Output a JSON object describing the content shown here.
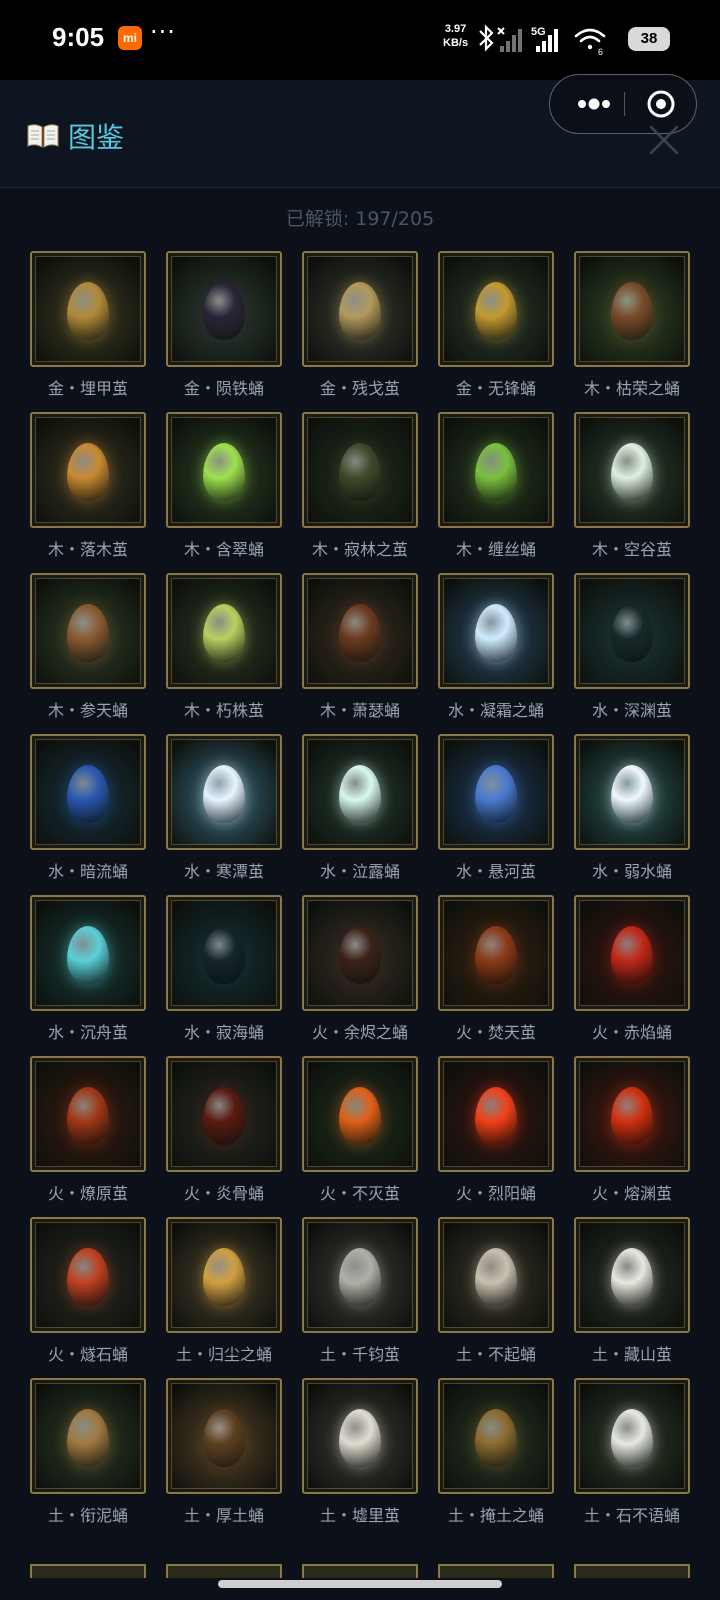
{
  "status_bar": {
    "time": "9:05",
    "mi_badge": "mi",
    "more_dots": "···",
    "net_speed_value": "3.97",
    "net_speed_unit": "KB/s",
    "network": "5G",
    "wifi_level": "6",
    "battery": "38"
  },
  "header": {
    "title": "图鉴",
    "icon": "open-book-icon",
    "accent_color": "#56c8e0"
  },
  "unlock_status": "已解锁: 197/205",
  "items": [
    {
      "label": "金・埋甲茧",
      "element": "金",
      "color": "#b08a3a",
      "bg": "#3d3a22"
    },
    {
      "label": "金・陨铁蛹",
      "element": "金",
      "color": "#2a2438",
      "bg": "#2f3d33"
    },
    {
      "label": "金・残戈茧",
      "element": "金",
      "color": "#b39a5a",
      "bg": "#3a3a30"
    },
    {
      "label": "金・无锋蛹",
      "element": "金",
      "color": "#c49a30",
      "bg": "#2c3a2a"
    },
    {
      "label": "木・枯荣之蛹",
      "element": "木",
      "color": "#7a4a2a",
      "bg": "#354a28"
    },
    {
      "label": "木・落木茧",
      "element": "木",
      "color": "#c88a30",
      "bg": "#3a3420"
    },
    {
      "label": "木・含翠蛹",
      "element": "木",
      "color": "#9fe050",
      "bg": "#2c4222"
    },
    {
      "label": "木・寂林之茧",
      "element": "木",
      "color": "#3e4a2a",
      "bg": "#24301e"
    },
    {
      "label": "木・缠丝蛹",
      "element": "木",
      "color": "#7ac040",
      "bg": "#28381e"
    },
    {
      "label": "木・空谷茧",
      "element": "木",
      "color": "#e0f0e0",
      "bg": "#2c3f2e"
    },
    {
      "label": "木・参天蛹",
      "element": "木",
      "color": "#8a5a30",
      "bg": "#33402a"
    },
    {
      "label": "木・朽株茧",
      "element": "木",
      "color": "#b8d060",
      "bg": "#2e3a24"
    },
    {
      "label": "木・萧瑟蛹",
      "element": "木",
      "color": "#6a3a20",
      "bg": "#3a2e22"
    },
    {
      "label": "水・凝霜之蛹",
      "element": "水",
      "color": "#d0ecff",
      "bg": "#2a4a66"
    },
    {
      "label": "水・深渊茧",
      "element": "水",
      "color": "#18282a",
      "bg": "#1e3a3a"
    },
    {
      "label": "水・暗流蛹",
      "element": "水",
      "color": "#2a58b0",
      "bg": "#183240"
    },
    {
      "label": "水・寒潭茧",
      "element": "水",
      "color": "#e8f4ff",
      "bg": "#3a6a80"
    },
    {
      "label": "水・泣露蛹",
      "element": "水",
      "color": "#d8f8f0",
      "bg": "#243a2e"
    },
    {
      "label": "水・悬河茧",
      "element": "水",
      "color": "#4a7ad0",
      "bg": "#1e3a5a"
    },
    {
      "label": "水・弱水蛹",
      "element": "水",
      "color": "#f0f8ff",
      "bg": "#2a5a58"
    },
    {
      "label": "水・沉舟茧",
      "element": "水",
      "color": "#5ad0d8",
      "bg": "#1a3a3a"
    },
    {
      "label": "水・寂海蛹",
      "element": "水",
      "color": "#142428",
      "bg": "#163238"
    },
    {
      "label": "火・余烬之蛹",
      "element": "火",
      "color": "#3a2218",
      "bg": "#3a3028"
    },
    {
      "label": "火・焚天茧",
      "element": "火",
      "color": "#8a3a18",
      "bg": "#3a2210"
    },
    {
      "label": "火・赤焰蛹",
      "element": "火",
      "color": "#c02818",
      "bg": "#3a1410"
    },
    {
      "label": "火・燎原茧",
      "element": "火",
      "color": "#a03818",
      "bg": "#3a1a10"
    },
    {
      "label": "火・炎骨蛹",
      "element": "火",
      "color": "#5a1a10",
      "bg": "#2a2a22"
    },
    {
      "label": "火・不灭茧",
      "element": "火",
      "color": "#e06018",
      "bg": "#22301e"
    },
    {
      "label": "火・烈阳蛹",
      "element": "火",
      "color": "#f04018",
      "bg": "#3a1410"
    },
    {
      "label": "火・熔渊茧",
      "element": "火",
      "color": "#d03010",
      "bg": "#4a1810"
    },
    {
      "label": "火・燧石蛹",
      "element": "火",
      "color": "#c04020",
      "bg": "#2a2a22"
    },
    {
      "label": "土・归尘之蛹",
      "element": "土",
      "color": "#d0a040",
      "bg": "#4a3e2a"
    },
    {
      "label": "土・千钧茧",
      "element": "土",
      "color": "#b0b0a8",
      "bg": "#3a3a34"
    },
    {
      "label": "土・不起蛹",
      "element": "土",
      "color": "#c8c0b0",
      "bg": "#3a3428"
    },
    {
      "label": "土・藏山茧",
      "element": "土",
      "color": "#e8e8e0",
      "bg": "#2a3026"
    },
    {
      "label": "土・衔泥蛹",
      "element": "土",
      "color": "#a07840",
      "bg": "#2e3a26"
    },
    {
      "label": "土・厚土蛹",
      "element": "土",
      "color": "#5a4020",
      "bg": "#5a4228"
    },
    {
      "label": "土・墟里茧",
      "element": "土",
      "color": "#e0dcd0",
      "bg": "#3a3a34"
    },
    {
      "label": "土・掩土之蛹",
      "element": "土",
      "color": "#8a6a30",
      "bg": "#2a3624"
    },
    {
      "label": "土・石不语蛹",
      "element": "土",
      "color": "#e8e8e4",
      "bg": "#2e3a2a"
    }
  ]
}
